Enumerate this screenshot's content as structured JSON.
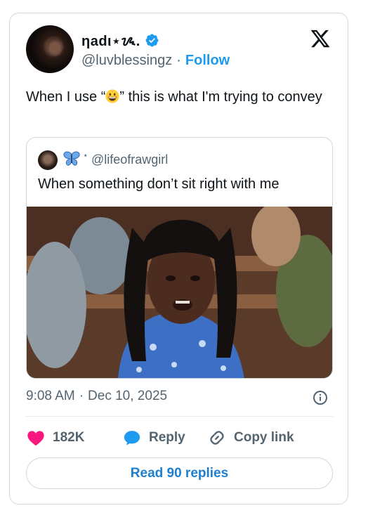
{
  "author": {
    "display_name": "ηadι⋆ᝰ.",
    "handle": "@luvblessingz",
    "separator": "·",
    "follow_label": "Follow"
  },
  "tweet": {
    "text_before": "When I use “",
    "text_after": "” this is what I'm trying to convey",
    "emoji": "grinning-face"
  },
  "quote": {
    "handle": "@lifeofrawgirl",
    "text": "When something don’t sit right with me"
  },
  "meta": {
    "time": "9:08 AM",
    "separator": "·",
    "date": "Dec 10, 2025"
  },
  "actions": {
    "likes": "182K",
    "reply_label": "Reply",
    "copy_label": "Copy link"
  },
  "read_replies_label": "Read 90 replies",
  "colors": {
    "accent": "#1d9bf0",
    "heart": "#f91880",
    "muted": "#536471"
  }
}
